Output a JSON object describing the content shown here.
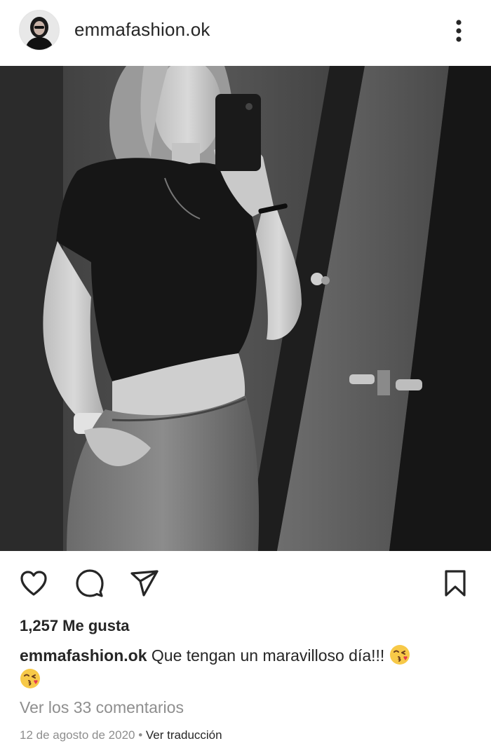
{
  "header": {
    "username": "emmafashion.ok",
    "avatar_icon": "profile-photo",
    "more_icon": "more-vertical-icon"
  },
  "photo": {
    "kind": "black-and-white mirror selfie"
  },
  "actions": {
    "like_icon": "heart-icon",
    "comment_icon": "comment-icon",
    "share_icon": "send-icon",
    "save_icon": "bookmark-icon"
  },
  "post": {
    "likes_text": "1,257 Me gusta",
    "caption_user": "emmafashion.ok",
    "caption_text": "Que tengan un maravilloso día!!!",
    "caption_emoji": "kissing-face-emoji",
    "comments_link": "Ver los 33 comentarios",
    "date": "12 de agosto de 2020",
    "separator": "•",
    "translate_link": "Ver traducción"
  },
  "colors": {
    "text_primary": "#262626",
    "text_secondary": "#8e8e8e",
    "background": "#ffffff"
  }
}
